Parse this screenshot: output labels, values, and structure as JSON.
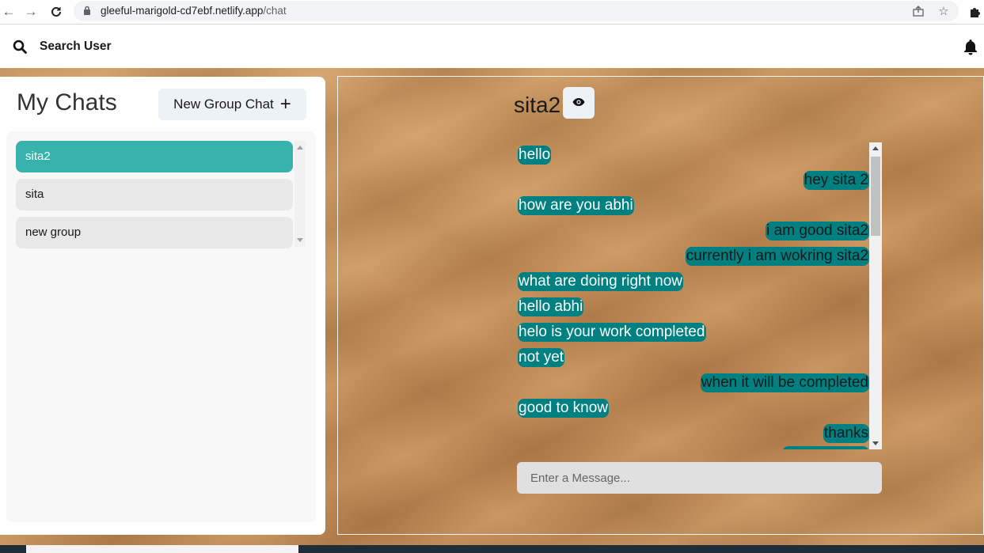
{
  "browser": {
    "url_host": "gleeful-marigold-cd7ebf.netlify.app",
    "url_path": "/chat"
  },
  "header": {
    "search_label": "Search User"
  },
  "sidebar": {
    "title": "My Chats",
    "new_group_label": "New Group Chat",
    "chats": [
      {
        "name": "sita2",
        "active": true
      },
      {
        "name": "sita",
        "active": false
      },
      {
        "name": "new group",
        "active": false
      }
    ]
  },
  "chat": {
    "title": "sita2",
    "messages": [
      {
        "text": "hello",
        "side": "left"
      },
      {
        "text": "hey sita 2",
        "side": "right"
      },
      {
        "text": "how are you abhi",
        "side": "left"
      },
      {
        "text": "i am good sita2",
        "side": "right"
      },
      {
        "text": "currently i am wokring sita2",
        "side": "right"
      },
      {
        "text": "what are doing right now",
        "side": "left"
      },
      {
        "text": "hello abhi",
        "side": "left"
      },
      {
        "text": "helo is your work completed",
        "side": "left"
      },
      {
        "text": "not yet",
        "side": "left"
      },
      {
        "text": "when it will be completed",
        "side": "right"
      },
      {
        "text": "good to know",
        "side": "left"
      },
      {
        "text": "thanks",
        "side": "right"
      }
    ],
    "input_placeholder": "Enter a Message..."
  },
  "colors": {
    "active_chat": "#38b2ac",
    "message_bubble": "#008080"
  }
}
